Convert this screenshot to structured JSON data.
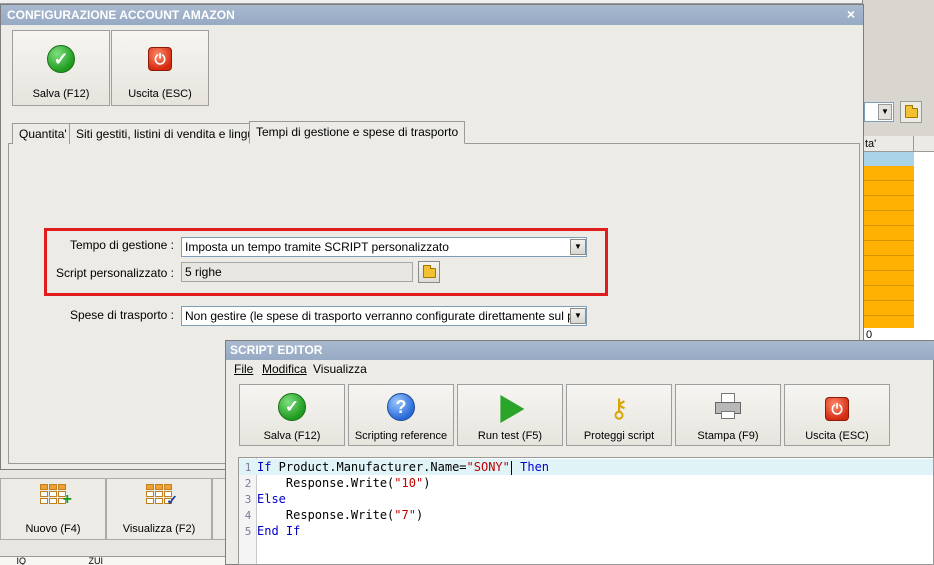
{
  "main_dialog": {
    "title": "CONFIGURAZIONE ACCOUNT AMAZON",
    "close": "×",
    "toolbar": {
      "save_label": "Salva (F12)",
      "exit_label": "Uscita (ESC)"
    },
    "tabs": [
      {
        "label": "Quantita'"
      },
      {
        "label": "Siti gestiti, listini di vendita e lingue"
      },
      {
        "label": "Tempi di gestione e spese di trasporto"
      }
    ],
    "form": {
      "tempo_label": "Tempo di gestione :",
      "tempo_value": "Imposta un tempo tramite SCRIPT personalizzato",
      "script_label": "Script personalizzato :",
      "script_value": "5 righe",
      "spese_label": "Spese di trasporto :",
      "spese_value": "Non gestire (le spese di trasporto verranno configurate direttamente sul portale"
    }
  },
  "background": {
    "grid_header": "ta'",
    "grid_value": "0",
    "bottom_buttons": [
      {
        "label": "Nuovo (F4)"
      },
      {
        "label": "Visualizza (F2)"
      }
    ],
    "bottom_strip": "     IQ                         ZUI"
  },
  "script_editor": {
    "title": "SCRIPT EDITOR",
    "menu": [
      "File",
      "Modifica",
      "Visualizza"
    ],
    "toolbar": [
      {
        "label": "Salva (F12)"
      },
      {
        "label": "Scripting reference"
      },
      {
        "label": "Run test (F5)"
      },
      {
        "label": "Proteggi script"
      },
      {
        "label": "Stampa (F9)"
      },
      {
        "label": "Uscita (ESC)"
      }
    ],
    "code": {
      "line_numbers": [
        "1",
        "2",
        "3",
        "4",
        "5"
      ],
      "l1_if": "If",
      "l1_expr": " Product.Manufacturer.Name=",
      "l1_str": "\"SONY\"",
      "l1_then": " Then",
      "l2_call": "    Response.Write(",
      "l2_str": "\"10\"",
      "l2_close": ")",
      "l3_else": "Else",
      "l4_call": "    Response.Write(",
      "l4_str": "\"7\"",
      "l4_close": ")",
      "l5_end": "End If"
    }
  }
}
